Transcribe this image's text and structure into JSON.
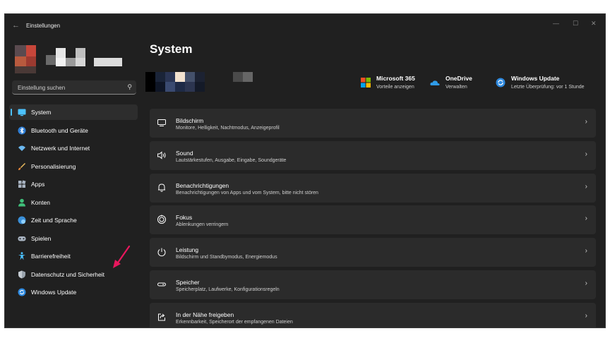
{
  "window": {
    "title": "Einstellungen",
    "back_glyph": "←",
    "controls": [
      "—",
      "☐",
      "✕"
    ]
  },
  "search": {
    "placeholder": "Einstellung suchen",
    "icon": "search-icon"
  },
  "sidebar": {
    "items": [
      {
        "label": "System",
        "icon": "system-display-icon",
        "active": true
      },
      {
        "label": "Bluetooth und Geräte",
        "icon": "bluetooth-icon"
      },
      {
        "label": "Netzwerk und Internet",
        "icon": "wifi-icon"
      },
      {
        "label": "Personalisierung",
        "icon": "brush-icon"
      },
      {
        "label": "Apps",
        "icon": "apps-icon"
      },
      {
        "label": "Konten",
        "icon": "person-icon"
      },
      {
        "label": "Zeit und Sprache",
        "icon": "globe-clock-icon"
      },
      {
        "label": "Spielen",
        "icon": "gamepad-icon"
      },
      {
        "label": "Barrierefreiheit",
        "icon": "accessibility-icon"
      },
      {
        "label": "Datenschutz und Sicherheit",
        "icon": "shield-icon"
      },
      {
        "label": "Windows Update",
        "icon": "windows-update-icon"
      }
    ]
  },
  "main": {
    "title": "System",
    "quick_links": [
      {
        "title": "Microsoft 365",
        "subtitle": "Vorteile anzeigen",
        "icon": "microsoft-logo-icon"
      },
      {
        "title": "OneDrive",
        "subtitle": "Verwalten",
        "icon": "onedrive-cloud-icon"
      },
      {
        "title": "Windows Update",
        "subtitle": "Letzte Überprüfung: vor 1 Stunde",
        "icon": "windows-update-icon"
      }
    ],
    "cards": [
      {
        "title": "Bildschirm",
        "subtitle": "Monitore, Helligkeit, Nachtmodus, Anzeigeprofil",
        "icon": "monitor-icon"
      },
      {
        "title": "Sound",
        "subtitle": "Lautstärkestufen, Ausgabe, Eingabe, Soundgeräte",
        "icon": "speaker-icon"
      },
      {
        "title": "Benachrichtigungen",
        "subtitle": "Benachrichtigungen von Apps und vom System, bitte nicht stören",
        "icon": "bell-icon"
      },
      {
        "title": "Fokus",
        "subtitle": "Ablenkungen verringern",
        "icon": "focus-icon"
      },
      {
        "title": "Leistung",
        "subtitle": "Bildschirm und Standbymodus, Energiemodus",
        "icon": "power-icon"
      },
      {
        "title": "Speicher",
        "subtitle": "Speicherplatz, Laufwerke, Konfigurationsregeln",
        "icon": "storage-icon"
      },
      {
        "title": "In der Nähe freigeben",
        "subtitle": "Erkennbarkeit, Speicherort der empfangenen Dateien",
        "icon": "share-icon"
      }
    ],
    "chevron": "›"
  },
  "colors": {
    "accent": "#4cc2ff",
    "annotation_arrow": "#e8175d",
    "background": "#202020",
    "card": "#2b2b2b"
  }
}
